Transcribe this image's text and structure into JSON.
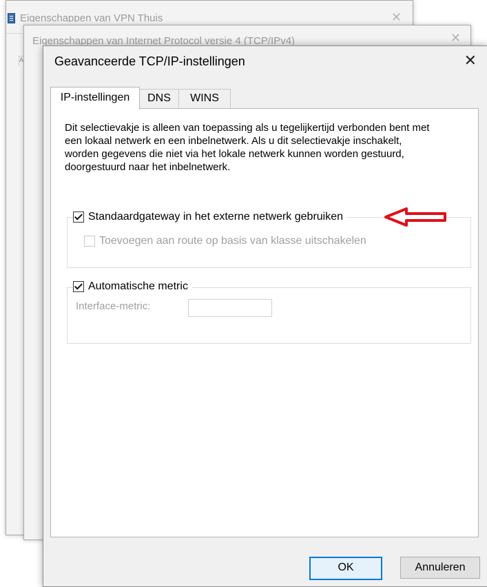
{
  "back_window": {
    "title": "Eigenschappen van VPN Thuis",
    "close_glyph": "✕",
    "tab_fragment": "A"
  },
  "middle_window": {
    "title": "Eigenschappen van Internet Protocol versie 4 (TCP/IPv4)",
    "close_glyph": "✕"
  },
  "dialog": {
    "title": "Geavanceerde TCP/IP-instellingen",
    "close_glyph": "✕",
    "tabs": [
      {
        "label": "IP-instellingen",
        "active": true
      },
      {
        "label": "DNS",
        "active": false
      },
      {
        "label": "WINS",
        "active": false
      }
    ],
    "description": "Dit selectievakje is alleen van toepassing als u tegelijkertijd verbonden bent met een lokaal netwerk en een inbelnetwerk. Als u dit selectievakje inschakelt, worden gegevens die niet via het lokale netwerk kunnen worden gestuurd, doorgestuurd naar het inbelnetwerk.",
    "gateway_checkbox": {
      "label": "Standaardgateway in het externe netwerk gebruiken",
      "checked": true
    },
    "class_route_checkbox": {
      "label": "Toevoegen aan route op basis van klasse uitschakelen",
      "checked": false,
      "enabled": false
    },
    "auto_metric_checkbox": {
      "label": "Automatische metric",
      "checked": true
    },
    "interface_metric": {
      "label": "Interface-metric:",
      "value": "",
      "enabled": false
    },
    "buttons": {
      "ok": "OK",
      "cancel": "Annuleren"
    },
    "annotation_arrow_color": "#e0101a"
  }
}
